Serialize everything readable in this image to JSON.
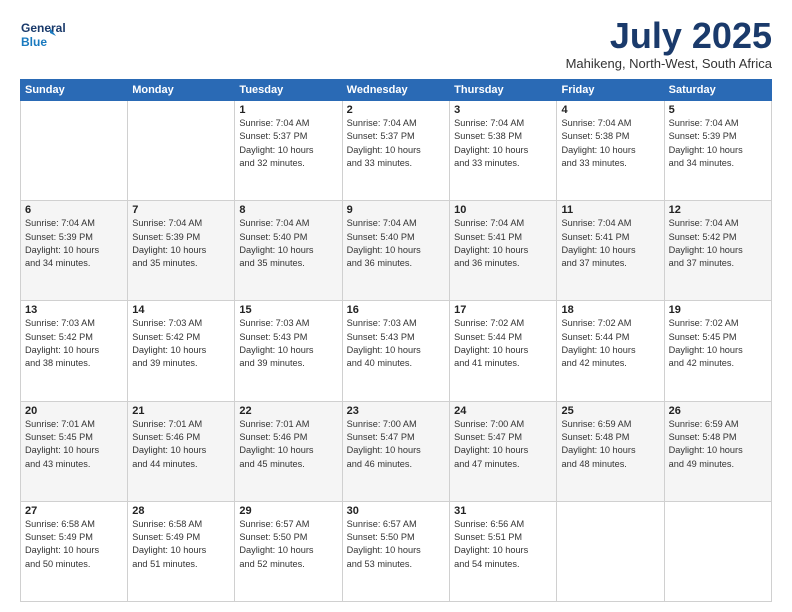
{
  "header": {
    "logo_line1": "General",
    "logo_line2": "Blue",
    "month_title": "July 2025",
    "subtitle": "Mahikeng, North-West, South Africa"
  },
  "weekdays": [
    "Sunday",
    "Monday",
    "Tuesday",
    "Wednesday",
    "Thursday",
    "Friday",
    "Saturday"
  ],
  "weeks": [
    [
      {
        "day": "",
        "info": ""
      },
      {
        "day": "",
        "info": ""
      },
      {
        "day": "1",
        "info": "Sunrise: 7:04 AM\nSunset: 5:37 PM\nDaylight: 10 hours\nand 32 minutes."
      },
      {
        "day": "2",
        "info": "Sunrise: 7:04 AM\nSunset: 5:37 PM\nDaylight: 10 hours\nand 33 minutes."
      },
      {
        "day": "3",
        "info": "Sunrise: 7:04 AM\nSunset: 5:38 PM\nDaylight: 10 hours\nand 33 minutes."
      },
      {
        "day": "4",
        "info": "Sunrise: 7:04 AM\nSunset: 5:38 PM\nDaylight: 10 hours\nand 33 minutes."
      },
      {
        "day": "5",
        "info": "Sunrise: 7:04 AM\nSunset: 5:39 PM\nDaylight: 10 hours\nand 34 minutes."
      }
    ],
    [
      {
        "day": "6",
        "info": "Sunrise: 7:04 AM\nSunset: 5:39 PM\nDaylight: 10 hours\nand 34 minutes."
      },
      {
        "day": "7",
        "info": "Sunrise: 7:04 AM\nSunset: 5:39 PM\nDaylight: 10 hours\nand 35 minutes."
      },
      {
        "day": "8",
        "info": "Sunrise: 7:04 AM\nSunset: 5:40 PM\nDaylight: 10 hours\nand 35 minutes."
      },
      {
        "day": "9",
        "info": "Sunrise: 7:04 AM\nSunset: 5:40 PM\nDaylight: 10 hours\nand 36 minutes."
      },
      {
        "day": "10",
        "info": "Sunrise: 7:04 AM\nSunset: 5:41 PM\nDaylight: 10 hours\nand 36 minutes."
      },
      {
        "day": "11",
        "info": "Sunrise: 7:04 AM\nSunset: 5:41 PM\nDaylight: 10 hours\nand 37 minutes."
      },
      {
        "day": "12",
        "info": "Sunrise: 7:04 AM\nSunset: 5:42 PM\nDaylight: 10 hours\nand 37 minutes."
      }
    ],
    [
      {
        "day": "13",
        "info": "Sunrise: 7:03 AM\nSunset: 5:42 PM\nDaylight: 10 hours\nand 38 minutes."
      },
      {
        "day": "14",
        "info": "Sunrise: 7:03 AM\nSunset: 5:42 PM\nDaylight: 10 hours\nand 39 minutes."
      },
      {
        "day": "15",
        "info": "Sunrise: 7:03 AM\nSunset: 5:43 PM\nDaylight: 10 hours\nand 39 minutes."
      },
      {
        "day": "16",
        "info": "Sunrise: 7:03 AM\nSunset: 5:43 PM\nDaylight: 10 hours\nand 40 minutes."
      },
      {
        "day": "17",
        "info": "Sunrise: 7:02 AM\nSunset: 5:44 PM\nDaylight: 10 hours\nand 41 minutes."
      },
      {
        "day": "18",
        "info": "Sunrise: 7:02 AM\nSunset: 5:44 PM\nDaylight: 10 hours\nand 42 minutes."
      },
      {
        "day": "19",
        "info": "Sunrise: 7:02 AM\nSunset: 5:45 PM\nDaylight: 10 hours\nand 42 minutes."
      }
    ],
    [
      {
        "day": "20",
        "info": "Sunrise: 7:01 AM\nSunset: 5:45 PM\nDaylight: 10 hours\nand 43 minutes."
      },
      {
        "day": "21",
        "info": "Sunrise: 7:01 AM\nSunset: 5:46 PM\nDaylight: 10 hours\nand 44 minutes."
      },
      {
        "day": "22",
        "info": "Sunrise: 7:01 AM\nSunset: 5:46 PM\nDaylight: 10 hours\nand 45 minutes."
      },
      {
        "day": "23",
        "info": "Sunrise: 7:00 AM\nSunset: 5:47 PM\nDaylight: 10 hours\nand 46 minutes."
      },
      {
        "day": "24",
        "info": "Sunrise: 7:00 AM\nSunset: 5:47 PM\nDaylight: 10 hours\nand 47 minutes."
      },
      {
        "day": "25",
        "info": "Sunrise: 6:59 AM\nSunset: 5:48 PM\nDaylight: 10 hours\nand 48 minutes."
      },
      {
        "day": "26",
        "info": "Sunrise: 6:59 AM\nSunset: 5:48 PM\nDaylight: 10 hours\nand 49 minutes."
      }
    ],
    [
      {
        "day": "27",
        "info": "Sunrise: 6:58 AM\nSunset: 5:49 PM\nDaylight: 10 hours\nand 50 minutes."
      },
      {
        "day": "28",
        "info": "Sunrise: 6:58 AM\nSunset: 5:49 PM\nDaylight: 10 hours\nand 51 minutes."
      },
      {
        "day": "29",
        "info": "Sunrise: 6:57 AM\nSunset: 5:50 PM\nDaylight: 10 hours\nand 52 minutes."
      },
      {
        "day": "30",
        "info": "Sunrise: 6:57 AM\nSunset: 5:50 PM\nDaylight: 10 hours\nand 53 minutes."
      },
      {
        "day": "31",
        "info": "Sunrise: 6:56 AM\nSunset: 5:51 PM\nDaylight: 10 hours\nand 54 minutes."
      },
      {
        "day": "",
        "info": ""
      },
      {
        "day": "",
        "info": ""
      }
    ]
  ]
}
